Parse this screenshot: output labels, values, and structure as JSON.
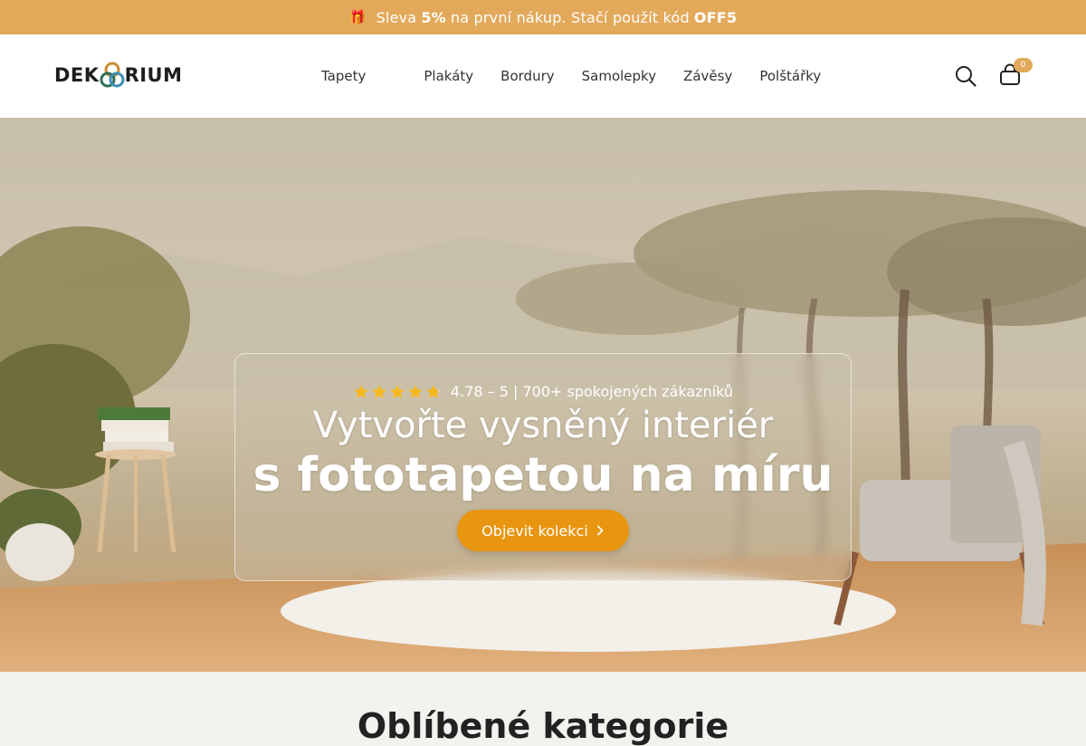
{
  "promo": {
    "icon": "gift-icon",
    "text_1": "Sleva",
    "discount": "5%",
    "text_2": "na první nákup. Stačí použít kód",
    "code": "OFF5",
    "background": "#e3a95b"
  },
  "header": {
    "logo_text_left": "DEK",
    "logo_text_right": "RIUM",
    "nav": [
      "Tapety",
      "Plakáty",
      "Bordury",
      "Samolepky",
      "Závěsy",
      "Polštářky"
    ],
    "search_icon": "search-icon",
    "cart_icon": "cart-icon",
    "cart_count": "0"
  },
  "hero": {
    "rating_text": "4.78 – 5 | 700+ spokojených zákazníků",
    "stars": 4.78,
    "title_line1": "Vytvořte vysněný interiér",
    "title_line2": "s fototapetou na míru",
    "cta_label": "Objevit kolekci",
    "cta_color": "#e8950f",
    "star_color": "#f5b81c"
  },
  "categories": {
    "title": "Oblíbené kategorie"
  }
}
